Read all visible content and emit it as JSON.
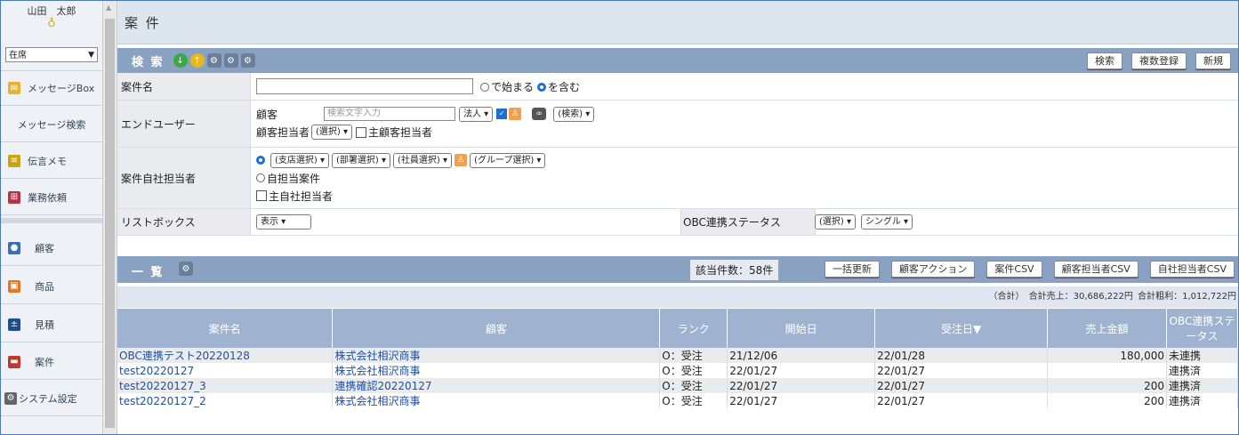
{
  "sidebar": {
    "user_name": "山田　太郎",
    "status_value": "在席",
    "items": [
      {
        "label": "メッセージBox",
        "icon": "envelope-icon"
      },
      {
        "label": "メッセージ検索"
      },
      {
        "label": "伝言メモ",
        "icon": "memo-icon"
      },
      {
        "label": "業務依頼",
        "icon": "gift-icon"
      },
      {
        "label": "顧客",
        "icon": "people-icon"
      },
      {
        "label": "商品",
        "icon": "cart-icon"
      },
      {
        "label": "見積",
        "icon": "calculator-icon"
      },
      {
        "label": "案件",
        "icon": "briefcase-icon"
      },
      {
        "label": "システム設定",
        "icon": "gear-icon"
      }
    ]
  },
  "page": {
    "title": "案 件"
  },
  "search": {
    "label": "検 索",
    "buttons": {
      "search": "検索",
      "multi_register": "複数登録",
      "new": "新規"
    },
    "fields": {
      "case_name_label": "案件名",
      "opt_starts": "で始まる",
      "opt_contains": "を含む",
      "enduser_label": "エンドユーザー",
      "customer_label": "顧客",
      "customer_placeholder": "検索文字入力",
      "corp_select": "法人",
      "search_select": "(検索)",
      "cust_rep_label": "顧客担当者",
      "cust_rep_select": "(選択)",
      "main_cust_rep": "主顧客担当者",
      "own_rep_label": "案件自社担当者",
      "branch_select": "(支店選択)",
      "dept_select": "(部署選択)",
      "staff_select": "(社員選択)",
      "group_select": "(グループ選択)",
      "own_case": "自担当案件",
      "main_own_rep": "主自社担当者",
      "listbox_label": "リストボックス",
      "listbox_value": "表示",
      "obc_label": "OBC連携ステータス",
      "obc_select": "(選択)",
      "single_select": "シングル"
    }
  },
  "list": {
    "label": "一 覧",
    "count": "該当件数：58件",
    "buttons": {
      "bulk_update": "一括更新",
      "customer_action": "顧客アクション",
      "case_csv": "案件CSV",
      "cust_rep_csv": "顧客担当者CSV",
      "own_rep_csv": "自社担当者CSV"
    },
    "totals": {
      "label": "（合計）",
      "sales": "合計売上：30,686,222円",
      "profit": "合計粗利：1,012,722円"
    },
    "columns": [
      "案件名",
      "顧客",
      "ランク",
      "開始日",
      "受注日▼",
      "売上金額",
      "OBC連携ステータス"
    ],
    "rows": [
      {
        "name": "OBC連携テスト20220128",
        "customer": "株式会社相沢商事",
        "rank": "O：受注",
        "start": "21/12/06",
        "order": "22/01/28",
        "amount": "180,000",
        "obc": "未連携"
      },
      {
        "name": "test20220127",
        "customer": "株式会社相沢商事",
        "rank": "O：受注",
        "start": "22/01/27",
        "order": "22/01/27",
        "amount": "",
        "obc": "連携済"
      },
      {
        "name": "test20220127_3",
        "customer": "連携確認20220127",
        "rank": "O：受注",
        "start": "22/01/27",
        "order": "22/01/27",
        "amount": "200",
        "obc": "連携済"
      },
      {
        "name": "test20220127_2",
        "customer": "株式会社相沢商事",
        "rank": "O：受注",
        "start": "22/01/27",
        "order": "22/01/27",
        "amount": "200",
        "obc": "連携済"
      }
    ]
  }
}
